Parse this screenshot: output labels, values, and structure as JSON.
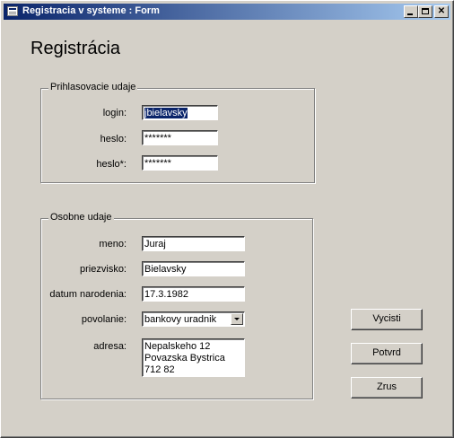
{
  "window": {
    "title": "Registracia v systeme : Form",
    "controls": {
      "minimize": "minimize-icon",
      "maximize": "maximize-icon",
      "close": "close-icon",
      "close_glyph": "✕"
    }
  },
  "form": {
    "title": "Registrácia"
  },
  "login_section": {
    "legend": "Prihlasovacie udaje",
    "login_label": "login:",
    "login_value": "jbielavsky",
    "password_label": "heslo:",
    "password_value": "*******",
    "password_confirm_label": "heslo*:",
    "password_confirm_value": "*******"
  },
  "personal_section": {
    "legend": "Osobne udaje",
    "name_label": "meno:",
    "name_value": "Juraj",
    "surname_label": "priezvisko:",
    "surname_value": "Bielavsky",
    "birthdate_label": "datum narodenia:",
    "birthdate_value": "17.3.1982",
    "occupation_label": "povolanie:",
    "occupation_value": "bankovy uradnik",
    "address_label": "adresa:",
    "address_value": "Nepalskeho 12\nPovazska Bystrica\n712 82"
  },
  "buttons": {
    "clear": "Vycisti",
    "confirm": "Potvrd",
    "cancel": "Zrus"
  },
  "colors": {
    "face": "#d4d0c8",
    "title_active": "#0a246a",
    "selection": "#0a246a"
  }
}
